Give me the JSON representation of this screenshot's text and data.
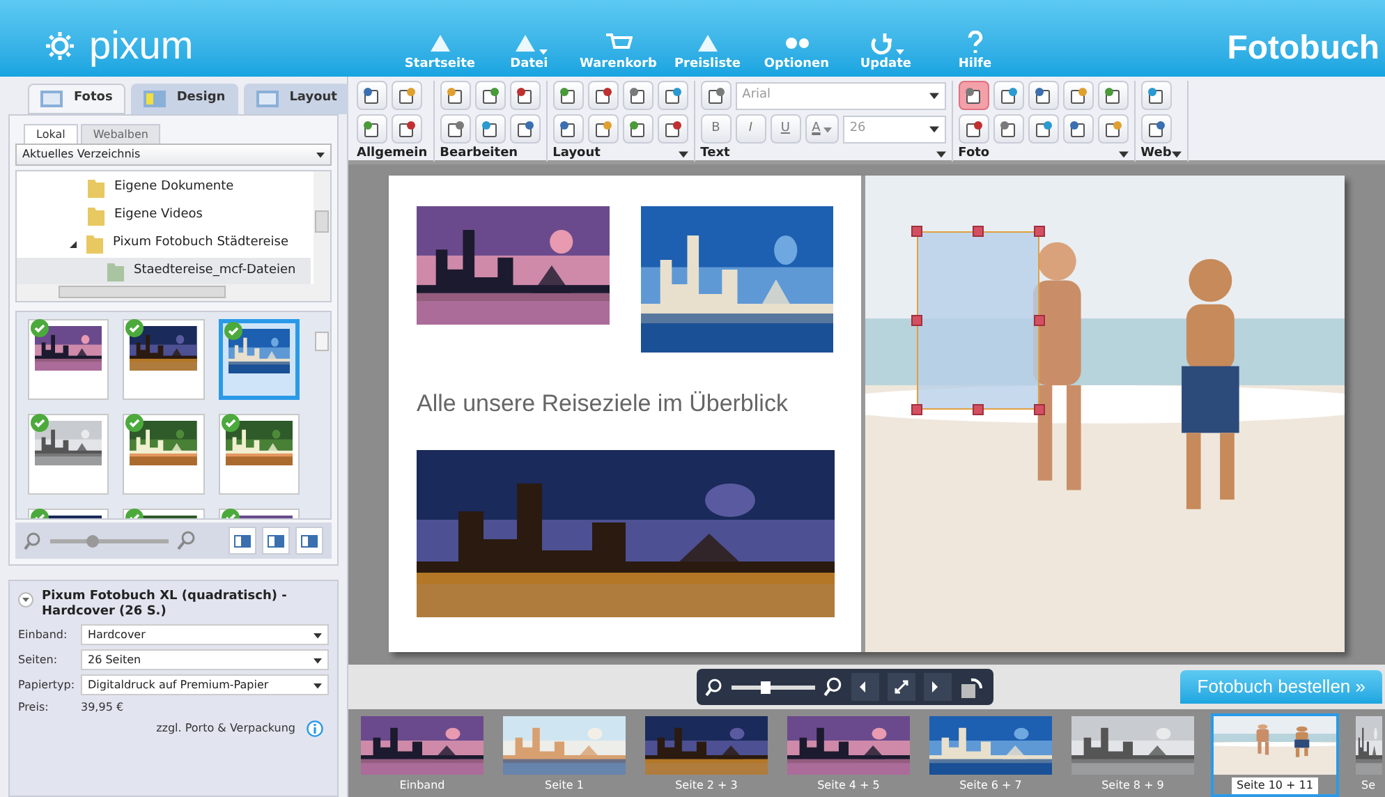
{
  "header": {
    "logo": "pixum",
    "title": "Fotobuch",
    "nav": [
      {
        "label": "Startseite",
        "menu": false
      },
      {
        "label": "Datei",
        "menu": true
      },
      {
        "label": "Warenkorb",
        "menu": false
      },
      {
        "label": "Preisliste",
        "menu": false
      },
      {
        "label": "Optionen",
        "menu": false
      },
      {
        "label": "Update",
        "menu": true
      },
      {
        "label": "Hilfe",
        "menu": false
      }
    ]
  },
  "left": {
    "tabs": [
      {
        "label": "Fotos",
        "selected": true
      },
      {
        "label": "Design",
        "selected": false
      },
      {
        "label": "Layout",
        "selected": false
      }
    ],
    "subtabs": [
      {
        "label": "Lokal",
        "selected": true
      },
      {
        "label": "Webalben",
        "selected": false
      }
    ],
    "directory": "Aktuelles Verzeichnis",
    "tree": [
      {
        "label": "Eigene Dokumente",
        "expanded": false,
        "selected": false
      },
      {
        "label": "Eigene Videos",
        "expanded": false,
        "selected": false
      },
      {
        "label": "Pixum Fotobuch Städtereise",
        "expanded": true,
        "selected": false,
        "children": [
          {
            "label": "Staedtereise_mcf-Dateien",
            "expanded": false,
            "selected": true
          }
        ]
      }
    ],
    "photos": [
      {
        "used": true,
        "selected": false
      },
      {
        "used": true,
        "selected": false
      },
      {
        "used": true,
        "selected": true
      },
      {
        "used": true,
        "selected": false
      },
      {
        "used": true,
        "selected": false
      },
      {
        "used": true,
        "selected": false
      },
      {
        "used": true,
        "selected": false
      },
      {
        "used": true,
        "selected": false
      },
      {
        "used": true,
        "selected": false
      }
    ],
    "zoom": {
      "level": 0.35
    },
    "product": {
      "title": "Pixum Fotobuch XL (quadratisch) - Hardcover (26 S.)",
      "expanded": true,
      "fields": [
        {
          "label": "Einband:",
          "value": "Hardcover"
        },
        {
          "label": "Seiten:",
          "value": "26 Seiten"
        },
        {
          "label": "Papiertyp:",
          "value": "Digitaldruck auf Premium-Papier"
        }
      ],
      "price_label": "Preis:",
      "price": "39,95 €",
      "note": "zzgl. Porto & Verpackung"
    }
  },
  "toolbar": {
    "groups": [
      {
        "kind": "icons",
        "label": "Allgemein",
        "menu": false,
        "buttons": [
          {
            "hovered": false
          },
          {
            "hovered": false
          },
          {
            "hovered": false
          },
          {
            "hovered": false
          }
        ]
      },
      {
        "kind": "icons",
        "label": "Bearbeiten",
        "menu": false,
        "buttons": [
          {
            "hovered": false
          },
          {
            "hovered": false
          },
          {
            "hovered": false
          },
          {
            "hovered": false
          },
          {
            "hovered": false
          },
          {
            "hovered": false
          }
        ]
      },
      {
        "kind": "icons",
        "label": "Layout",
        "menu": true,
        "buttons": [
          {
            "hovered": false
          },
          {
            "hovered": false
          },
          {
            "hovered": false
          },
          {
            "hovered": false
          },
          {
            "hovered": false
          },
          {
            "hovered": false
          },
          {
            "hovered": false
          },
          {
            "hovered": false
          }
        ]
      },
      {
        "kind": "text",
        "label": "Text",
        "menu": true,
        "font": "Arial",
        "size": "26",
        "format": [
          "B",
          "I",
          "U"
        ],
        "color_button": "A"
      },
      {
        "kind": "icons",
        "label": "Foto",
        "menu": true,
        "buttons": [
          {
            "hovered": true
          },
          {
            "hovered": false
          },
          {
            "hovered": false
          },
          {
            "hovered": false
          },
          {
            "hovered": false
          },
          {
            "hovered": false
          },
          {
            "hovered": false
          },
          {
            "hovered": false
          },
          {
            "hovered": false
          },
          {
            "hovered": false
          }
        ]
      },
      {
        "kind": "icons",
        "label": "Web",
        "menu": true,
        "buttons": [
          {
            "hovered": false
          },
          {
            "hovered": false
          }
        ]
      }
    ]
  },
  "spread": {
    "caption": "Alle unsere Reiseziele im Überblick"
  },
  "navigator": {
    "level": 0.4
  },
  "order_button": "Fotobuch bestellen »",
  "pages": [
    {
      "label": "Einband",
      "selected": false
    },
    {
      "label": "Seite 1",
      "selected": false
    },
    {
      "label": "Seite 2 + 3",
      "selected": false
    },
    {
      "label": "Seite 4 + 5",
      "selected": false
    },
    {
      "label": "Seite 6 + 7",
      "selected": false
    },
    {
      "label": "Seite 8 + 9",
      "selected": false
    },
    {
      "label": "Seite 10 + 11",
      "selected": true
    },
    {
      "label": "Se",
      "selected": false
    }
  ]
}
